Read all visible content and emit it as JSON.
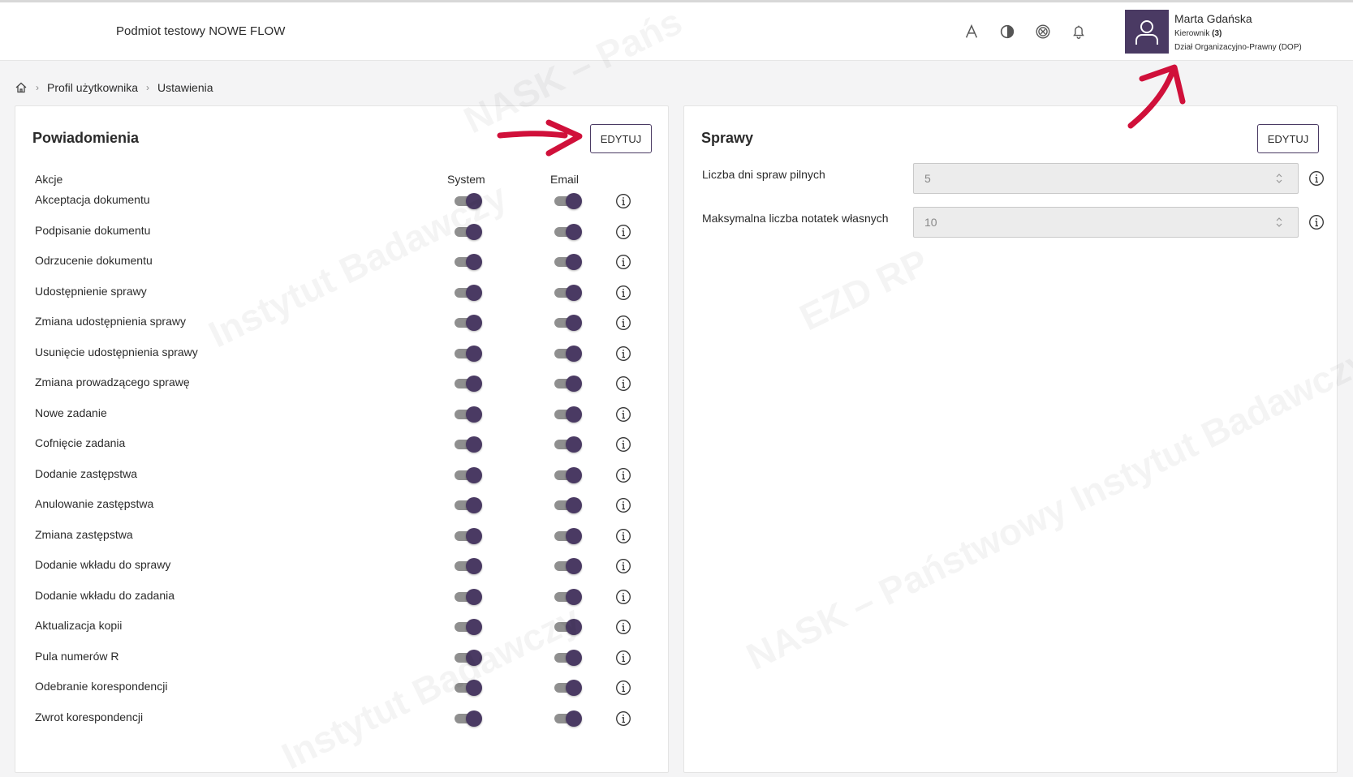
{
  "header": {
    "org_name": "Podmiot testowy NOWE FLOW",
    "icons": [
      "font-size-icon",
      "contrast-icon",
      "accessibility-icon",
      "bell-icon"
    ],
    "user": {
      "name": "Marta Gdańska",
      "role": "Kierownik",
      "role_count": "(3)",
      "department": "Dział Organizacyjno-Prawny (DOP)"
    }
  },
  "breadcrumb": {
    "items": [
      "Profil użytkownika",
      "Ustawienia"
    ]
  },
  "notifications": {
    "title": "Powiadomienia",
    "edit_label": "EDYTUJ",
    "columns": {
      "action": "Akcje",
      "system": "System",
      "email": "Email"
    },
    "rows": [
      {
        "label": "Akceptacja dokumentu",
        "system": true,
        "email": true
      },
      {
        "label": "Podpisanie dokumentu",
        "system": true,
        "email": true
      },
      {
        "label": "Odrzucenie dokumentu",
        "system": true,
        "email": true
      },
      {
        "label": "Udostępnienie sprawy",
        "system": true,
        "email": true
      },
      {
        "label": "Zmiana udostępnienia sprawy",
        "system": true,
        "email": true
      },
      {
        "label": "Usunięcie udostępnienia sprawy",
        "system": true,
        "email": true
      },
      {
        "label": "Zmiana prowadzącego sprawę",
        "system": true,
        "email": true
      },
      {
        "label": "Nowe zadanie",
        "system": true,
        "email": true
      },
      {
        "label": "Cofnięcie zadania",
        "system": true,
        "email": true
      },
      {
        "label": "Dodanie zastępstwa",
        "system": true,
        "email": true
      },
      {
        "label": "Anulowanie zastępstwa",
        "system": true,
        "email": true
      },
      {
        "label": "Zmiana zastępstwa",
        "system": true,
        "email": true
      },
      {
        "label": "Dodanie wkładu do sprawy",
        "system": true,
        "email": true
      },
      {
        "label": "Dodanie wkładu do zadania",
        "system": true,
        "email": true
      },
      {
        "label": "Aktualizacja kopii",
        "system": true,
        "email": true
      },
      {
        "label": "Pula numerów R",
        "system": true,
        "email": true
      },
      {
        "label": "Odebranie korespondencji",
        "system": true,
        "email": true
      },
      {
        "label": "Zwrot korespondencji",
        "system": true,
        "email": true
      }
    ]
  },
  "cases": {
    "title": "Sprawy",
    "edit_label": "EDYTUJ",
    "urgent_days_label": "Liczba dni spraw pilnych",
    "urgent_days_value": "5",
    "max_notes_label": "Maksymalna liczba notatek własnych",
    "max_notes_value": "10"
  },
  "colors": {
    "accent": "#4a3a63",
    "annotation_arrow": "#d0103a"
  }
}
